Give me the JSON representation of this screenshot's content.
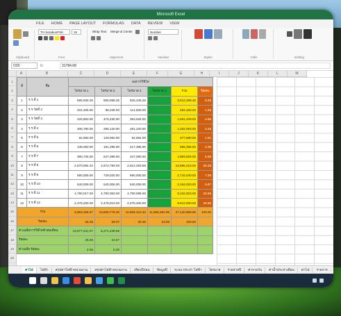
{
  "window_title": "Microsoft Excel",
  "menu": [
    "FILE",
    "HOME",
    "PAGE LAYOUT",
    "FORMULAS",
    "DATA",
    "REVIEW",
    "VIEW"
  ],
  "ribbon": {
    "font_name": "TH SarabunPSK",
    "font_size": "16",
    "groups": [
      "Clipboard",
      "Font",
      "Alignment",
      "Number",
      "Styles",
      "Cells",
      "Editing"
    ],
    "wrap_text": "Wrap Text",
    "merge_center": "Merge & Center",
    "number_format": "Number",
    "conditional": "Conditional Formatting",
    "format_table": "Format as Table",
    "cell_styles": "Cell Styles",
    "insert": "Insert",
    "delete": "Delete",
    "format": "Format",
    "autosum": "AutoSum",
    "fill": "Fill",
    "clear": "Clear",
    "sort": "Sort & Filter",
    "find": "Find & Select"
  },
  "formula_bar": {
    "name_box": "O20",
    "fx": "fx",
    "value": "31784.68"
  },
  "columns": [
    "A",
    "B",
    "C",
    "D",
    "E",
    "F",
    "G",
    "H",
    "I",
    "J",
    "K",
    "L",
    "M"
  ],
  "rows": [
    "1",
    "2",
    "3",
    "4",
    "5",
    "6",
    "7",
    "8",
    "9",
    "10",
    "11",
    "12",
    "13",
    "14",
    "15",
    "16",
    "17",
    "18",
    "19",
    "20",
    "21",
    "22",
    "23"
  ],
  "table": {
    "header_left": "ที่",
    "header_name": "ชื่อ",
    "header_group": "ผลการใช้ไฟ",
    "sub_headers": [
      "ไตรมาส 1",
      "ไตรมาส 2",
      "ไตรมาส 3",
      "ไตรมาส 4",
      "รวม",
      "ร้อยละ"
    ],
    "data": [
      [
        "1",
        "ร.ร.ที่ 1",
        "895,926.25",
        "559,088.25",
        "825,449.25",
        "712,342.25",
        "3,012,299.45",
        "8.25"
      ],
      [
        "2",
        "ร.ร.วัดที่ 2",
        "204,405.00",
        "88,228.00",
        "114,830.00",
        "87,023.00",
        "494,460.00",
        "1.25"
      ],
      [
        "3",
        "ร.ร.วัดที่ 3",
        "425,863.00",
        "476,430.00",
        "383,526.00",
        "395,604.00",
        "1,681,409.00",
        "4.65"
      ],
      [
        "4",
        "ร.ร.ที่ 4",
        "305,790.00",
        "286,120.00",
        "281,220.00",
        "289,764.00",
        "1,262,093.00",
        "3.46"
      ],
      [
        "5",
        "ร.ร.ที่ 5",
        "62,693.00",
        "129,092.00",
        "82,694.00",
        "103,211.00",
        "377,690.00",
        "1.01"
      ],
      [
        "6",
        "ร.ร.ที่ 6",
        "138,063.00",
        "181,295.00",
        "217,365.00",
        "319,098.00",
        "855,396.00",
        "2.36"
      ],
      [
        "7",
        "ร.ร.ที่ 7",
        "380,726.00",
        "647,089.00",
        "347,090.00",
        "508,721.00",
        "1,883,626.00",
        "5.06"
      ],
      [
        "8",
        "ร.ร.ที่ 8",
        "2,670,064.42",
        "2,672,794.00",
        "2,612,493.58",
        "2,940,864.00",
        "10,896,216.00",
        "29.48"
      ],
      [
        "9",
        "ร.ร.ที่ 9",
        "590,009.00",
        "729,020.00",
        "690,005.00",
        "706,906.00",
        "2,716,040.00",
        "7.39"
      ],
      [
        "10",
        "ร.ร.ที่ 10",
        "540,009.00",
        "540,006.00",
        "540,009.00",
        "542,009.00",
        "2,164,020.00",
        "5.87"
      ],
      [
        "11",
        "ร.ร.ที่ 11",
        "4,790,017.00",
        "4,790,053.00",
        "4,790,096.00",
        "4,790,017.00",
        "9,102,003.00",
        "25.68"
      ],
      [
        "12",
        "ร.ร.ที่ 12",
        "2,478,200.00",
        "2,478,013.00",
        "2,478,400.00",
        "2,478,200.00",
        "9,912,000.00",
        "26.85"
      ]
    ],
    "total_label": "รวม",
    "totals": [
      "9,993,326.67",
      "10,805,778.25",
      "10,906,410.33",
      "11,965,382.95",
      "37,140,899.95",
      "100.00"
    ],
    "avg_label": "ร้อยละ",
    "avgs": [
      "26.35",
      "29.07",
      "29.36",
      "23.59",
      "100.00"
    ],
    "extra_rows": [
      [
        "ค่าเฉลี่ยการใช้ไฟฟ้าต่อเดือน",
        "13,077,221.07",
        "8,271,439.56"
      ],
      [
        "ร้อยละ",
        "25.05",
        "15.57"
      ],
      [
        "ค่าเฉลี่ย ร้อยละ",
        "2.06",
        "0.29"
      ]
    ]
  },
  "sheet_tabs": [
    "ค่าไฟ",
    "ไฟฟ้า",
    "สรุปค่าไฟฟ้าหน่วยงาน",
    "สรุปค่าไฟฟ้าหน่วยงาน",
    "เทียบปีก่อน",
    "ข้อมูลปี",
    "ระบบ ประปา ไฟฟ้า",
    "ไตรมาส",
    "รายจ่ายปี",
    "ค่ารายวัน",
    "ค่าน้ำประปาเดือน",
    "ค่าไฟ",
    "รายการ ..."
  ],
  "active_sheet": "ค่าไฟ",
  "taskbar_icons": [
    "start-icon",
    "search-icon",
    "folder-icon",
    "edge-icon",
    "chrome-icon",
    "files-icon",
    "store-icon",
    "line-icon",
    "excel-icon"
  ],
  "colors": {
    "excel_green": "#217346",
    "accent_green": "#1fa33a",
    "accent_yellow": "#ffea00",
    "accent_orange": "#e06a12"
  }
}
